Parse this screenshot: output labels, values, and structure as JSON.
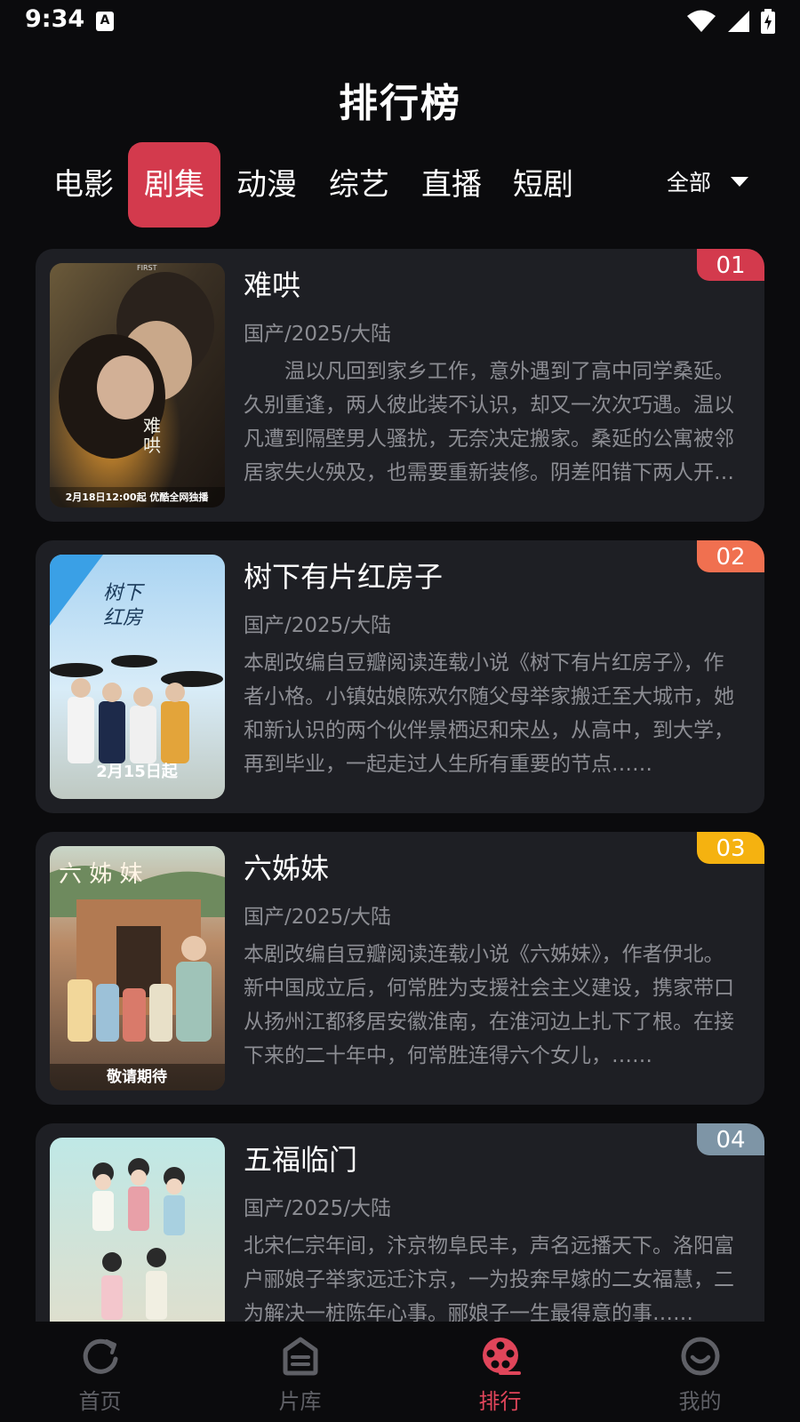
{
  "status_bar": {
    "time": "9:34",
    "notification_badge": "A"
  },
  "header": {
    "title": "排行榜"
  },
  "tabs": [
    {
      "label": "电影",
      "active": false
    },
    {
      "label": "剧集",
      "active": true
    },
    {
      "label": "动漫",
      "active": false
    },
    {
      "label": "综艺",
      "active": false
    },
    {
      "label": "直播",
      "active": false
    },
    {
      "label": "短剧",
      "active": false
    }
  ],
  "filter": {
    "label": "全部"
  },
  "colors": {
    "accent": "#d33a4d",
    "rank1": "#d33a4d",
    "rank2": "#f07050",
    "rank3": "#f5b210",
    "rank4": "#7e95a6"
  },
  "items": [
    {
      "rank": "01",
      "title": "难哄",
      "meta": "国产/2025/大陆",
      "desc": "　　温以凡回到家乡工作，意外遇到了高中同学桑延。久别重逢，两人彼此装不认识，却又一次次巧遇。温以凡遭到隔壁男人骚扰，无奈决定搬家。桑延的公寓被邻居家失火殃及，也需要重新装修。阴差阳错下两人开始合租……",
      "poster_caption": "2月18日12:00起 优酷全网独播"
    },
    {
      "rank": "02",
      "title": "树下有片红房子",
      "meta": "国产/2025/大陆",
      "desc": "本剧改编自豆瓣阅读连载小说《树下有片红房子》，作者小格。小镇姑娘陈欢尔随父母举家搬迁至大城市，她和新认识的两个伙伴景栖迟和宋丛，从高中，到大学，再到毕业，一起走过人生所有重要的节点……",
      "poster_caption": "2月15日起"
    },
    {
      "rank": "03",
      "title": "六姊妹",
      "meta": "国产/2025/大陆",
      "desc": "本剧改编自豆瓣阅读连载小说《六姊妹》，作者伊北。新中国成立后，何常胜为支援社会主义建设，携家带口从扬州江都移居安徽淮南，在淮河边上扎下了根。在接下来的二十年中，何常胜连得六个女儿，……",
      "poster_caption": "敬请期待"
    },
    {
      "rank": "04",
      "title": "五福临门",
      "meta": "国产/2025/大陆",
      "desc": "北宋仁宗年间，汴京物阜民丰，声名远播天下。洛阳富户郦娘子举家远迁汴京，一为投奔早嫁的二女福慧，二为解决一桩陈年心事。郦娘子一生最得意的事……",
      "poster_caption": ""
    }
  ],
  "bottom_nav": [
    {
      "label": "首页",
      "icon": "home-refresh-icon",
      "active": false
    },
    {
      "label": "片库",
      "icon": "library-icon",
      "active": false
    },
    {
      "label": "排行",
      "icon": "ranking-film-reel-icon",
      "active": true
    },
    {
      "label": "我的",
      "icon": "profile-smile-icon",
      "active": false
    }
  ]
}
